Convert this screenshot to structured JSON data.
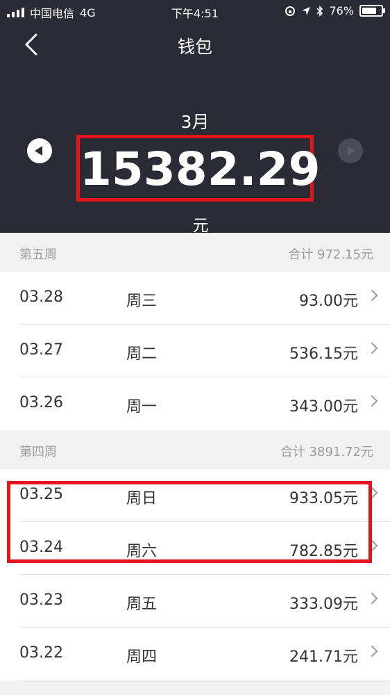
{
  "status_bar": {
    "carrier": "中国电信",
    "network": "4G",
    "time": "下午4:51",
    "battery": "76%",
    "icons": [
      "signal-icon",
      "lock-rotation-icon",
      "location-icon",
      "bluetooth-icon",
      "battery-icon"
    ]
  },
  "nav": {
    "title": "钱包"
  },
  "summary": {
    "month": "3月",
    "amount": "15382.29",
    "unit": "元"
  },
  "weeks": [
    {
      "name": "第五周",
      "total": "合计 972.15元",
      "days": [
        {
          "date": "03.28",
          "weekday": "周三",
          "amount": "93.00元"
        },
        {
          "date": "03.27",
          "weekday": "周二",
          "amount": "536.15元"
        },
        {
          "date": "03.26",
          "weekday": "周一",
          "amount": "343.00元"
        }
      ]
    },
    {
      "name": "第四周",
      "total": "合计 3891.72元",
      "days": [
        {
          "date": "03.25",
          "weekday": "周日",
          "amount": "933.05元"
        },
        {
          "date": "03.24",
          "weekday": "周六",
          "amount": "782.85元"
        },
        {
          "date": "03.23",
          "weekday": "周五",
          "amount": "333.09元"
        },
        {
          "date": "03.22",
          "weekday": "周四",
          "amount": "241.71元"
        }
      ]
    }
  ],
  "colors": {
    "header_bg": "#2b2b35",
    "highlight": "#e4121a",
    "page_bg": "#f1f1f1"
  }
}
